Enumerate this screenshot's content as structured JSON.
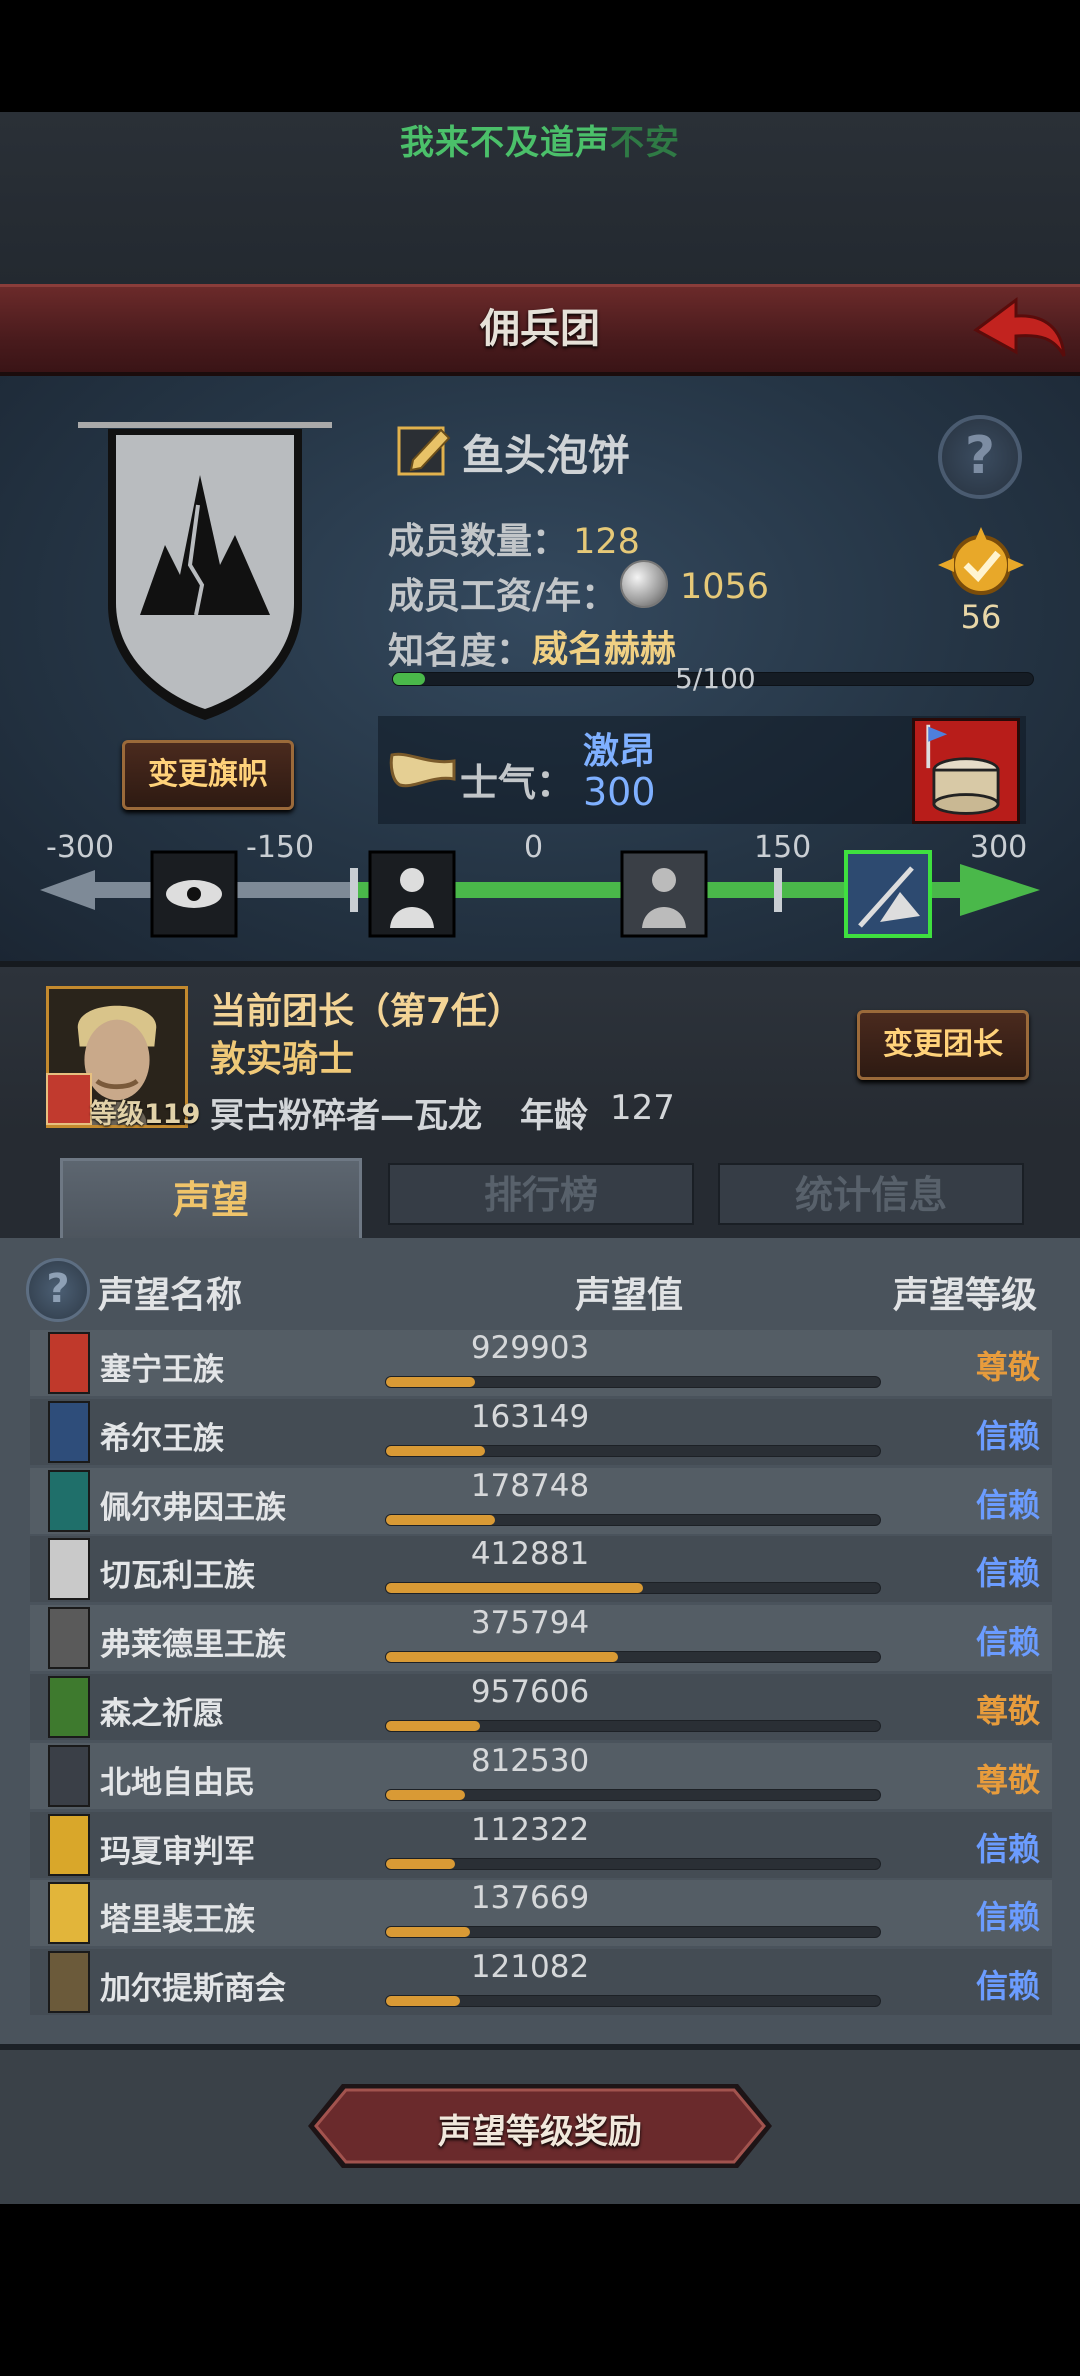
{
  "marquee": {
    "text_bright": "我来不及道声",
    "text_dim": "不安"
  },
  "header": {
    "title": "佣兵团"
  },
  "guild": {
    "name": "鱼头泡饼",
    "members_label": "成员数量：",
    "members": "128",
    "salary_label": "成员工资/年：",
    "salary": "1056",
    "fame_label": "知名度：",
    "fame_value": "威名赫赫",
    "fame_progress": "5/100",
    "fame_fraction": 0.05,
    "medal_count": "56",
    "change_flag_label": "变更旗帜",
    "help_symbol": "?"
  },
  "morale": {
    "label": "士气：",
    "state": "激昂",
    "value": "300",
    "scale_labels": [
      "-300",
      "-150",
      "0",
      "150",
      "300"
    ]
  },
  "leader": {
    "title": "当前团长（第7任）",
    "trait": "敦实骑士",
    "name": "冥古粉碎者—瓦龙",
    "age_label": "年龄",
    "age": "127",
    "level": "等级119",
    "change_label": "变更团长"
  },
  "tabs": [
    {
      "label": "声望",
      "active": true
    },
    {
      "label": "排行榜",
      "active": false
    },
    {
      "label": "统计信息",
      "active": false
    }
  ],
  "reputation": {
    "headers": {
      "name": "声望名称",
      "value": "声望值",
      "level": "声望等级"
    },
    "rows": [
      {
        "name": "塞宁王族",
        "value": "929903",
        "level": "尊敬",
        "tier": "respect",
        "fill": 0.18,
        "icon_color": "#c0392b"
      },
      {
        "name": "希尔王族",
        "value": "163149",
        "level": "信赖",
        "tier": "trust",
        "fill": 0.2,
        "icon_color": "#2e4d7a"
      },
      {
        "name": "佩尔弗因王族",
        "value": "178748",
        "level": "信赖",
        "tier": "trust",
        "fill": 0.22,
        "icon_color": "#1f6f6a"
      },
      {
        "name": "切瓦利王族",
        "value": "412881",
        "level": "信赖",
        "tier": "trust",
        "fill": 0.52,
        "icon_color": "#c9c9c9"
      },
      {
        "name": "弗莱德里王族",
        "value": "375794",
        "level": "信赖",
        "tier": "trust",
        "fill": 0.47,
        "icon_color": "#5a5a5a"
      },
      {
        "name": "森之祈愿",
        "value": "957606",
        "level": "尊敬",
        "tier": "respect",
        "fill": 0.19,
        "icon_color": "#3e7a2e"
      },
      {
        "name": "北地自由民",
        "value": "812530",
        "level": "尊敬",
        "tier": "respect",
        "fill": 0.16,
        "icon_color": "#3a3f47"
      },
      {
        "name": "玛夏审判军",
        "value": "112322",
        "level": "信赖",
        "tier": "trust",
        "fill": 0.14,
        "icon_color": "#d9a72a"
      },
      {
        "name": "塔里裴王族",
        "value": "137669",
        "level": "信赖",
        "tier": "trust",
        "fill": 0.17,
        "icon_color": "#e2b53a"
      },
      {
        "name": "加尔提斯商会",
        "value": "121082",
        "level": "信赖",
        "tier": "trust",
        "fill": 0.15,
        "icon_color": "#6b5a3a"
      }
    ]
  },
  "footer": {
    "reward_label": "声望等级奖励"
  }
}
